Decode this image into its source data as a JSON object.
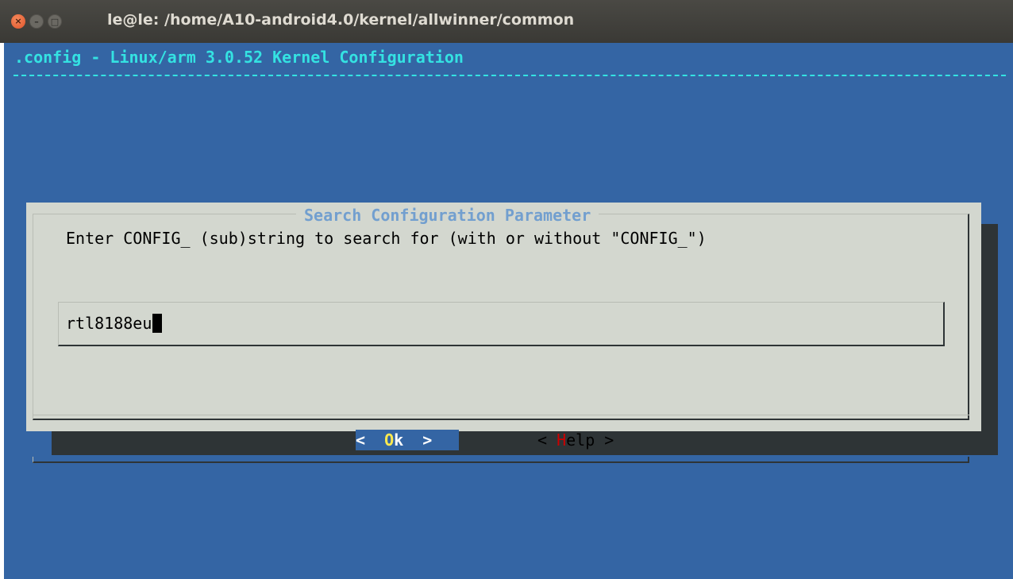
{
  "window": {
    "title": "le@le: /home/A10-android4.0/kernel/allwinner/common",
    "close_glyph": "×",
    "minimize_glyph": "–",
    "maximize_glyph": "□"
  },
  "terminal": {
    "header": ".config - Linux/arm 3.0.52 Kernel Configuration"
  },
  "dialog": {
    "title": "Search Configuration Parameter",
    "prompt": "Enter CONFIG_ (sub)string to search for (with or without \"CONFIG_\")",
    "input_value": "rtl8188eu",
    "ok": {
      "left": "<  ",
      "hotkey": "O",
      "rest": "k  >"
    },
    "help": {
      "left": "< ",
      "hotkey": "H",
      "rest": "elp >"
    }
  },
  "colors": {
    "terminal_bg": "#3465a4",
    "header_fg": "#34e2e2",
    "dialog_bg": "#d3d7cf",
    "dialog_title": "#729fcf",
    "shadow": "#2e3436",
    "selected_button_bg": "#3465a4",
    "selected_hotkey": "#fce94f",
    "hotkey": "#cc0000"
  }
}
